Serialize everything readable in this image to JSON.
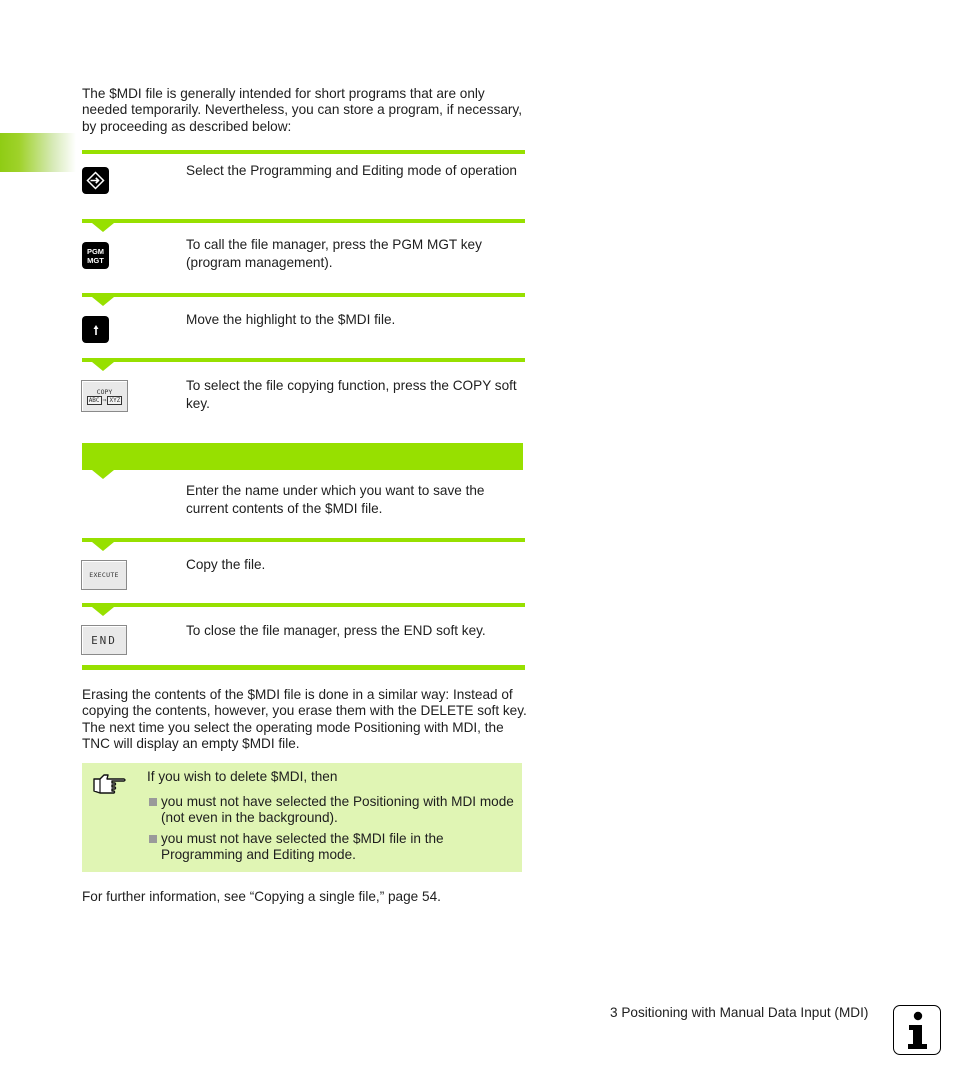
{
  "intro": "The $MDI file is generally intended for short programs that are only needed temporarily. Nevertheless, you can store a program, if necessary, by proceeding as described below:",
  "steps": [
    {
      "key": "programming-editing-mode-key",
      "text": "Select the Programming and Editing mode of operation"
    },
    {
      "key": "pgm-mgt-key",
      "key_label_line1": "PGM",
      "key_label_line2": "MGT",
      "text": "To call the file manager, press the PGM MGT key (program management)."
    },
    {
      "key": "arrow-up-key",
      "text": "Move the highlight to the $MDI file."
    },
    {
      "key": "copy-soft-key",
      "key_label": "COPY",
      "key_from": "ABC",
      "key_to": "XYZ",
      "text": "To select the file copying function, press the COPY soft key."
    },
    {
      "key": "none",
      "text": "Enter the name under which you want to save the current contents of the $MDI file."
    },
    {
      "key": "execute-soft-key",
      "key_label": "EXECUTE",
      "text": "Copy the file."
    },
    {
      "key": "end-soft-key",
      "key_label": "END",
      "text": "To close the file manager, press the END soft key."
    }
  ],
  "erase_paragraph": "Erasing the contents of the $MDI file is done in a similar way: Instead of copying the contents, however, you erase them with the DELETE soft key. The next time you select the operating mode Positioning with MDI, the TNC will display an empty $MDI file.",
  "note": {
    "icon": "pointing-hand-icon",
    "title": "If you wish to delete $MDI, then",
    "bullets": [
      "you must not have selected the Positioning with MDI mode (not even in the background).",
      "you must not have selected the $MDI file in the Programming and Editing mode."
    ]
  },
  "further_info": "For further information, see “Copying a single file,” page 54.",
  "footer": {
    "chapter": "3 Positioning with Manual Data Input (MDI)",
    "icon": "info-icon"
  },
  "colors": {
    "accent_green": "#97e000",
    "note_background": "#e0f5b4"
  }
}
